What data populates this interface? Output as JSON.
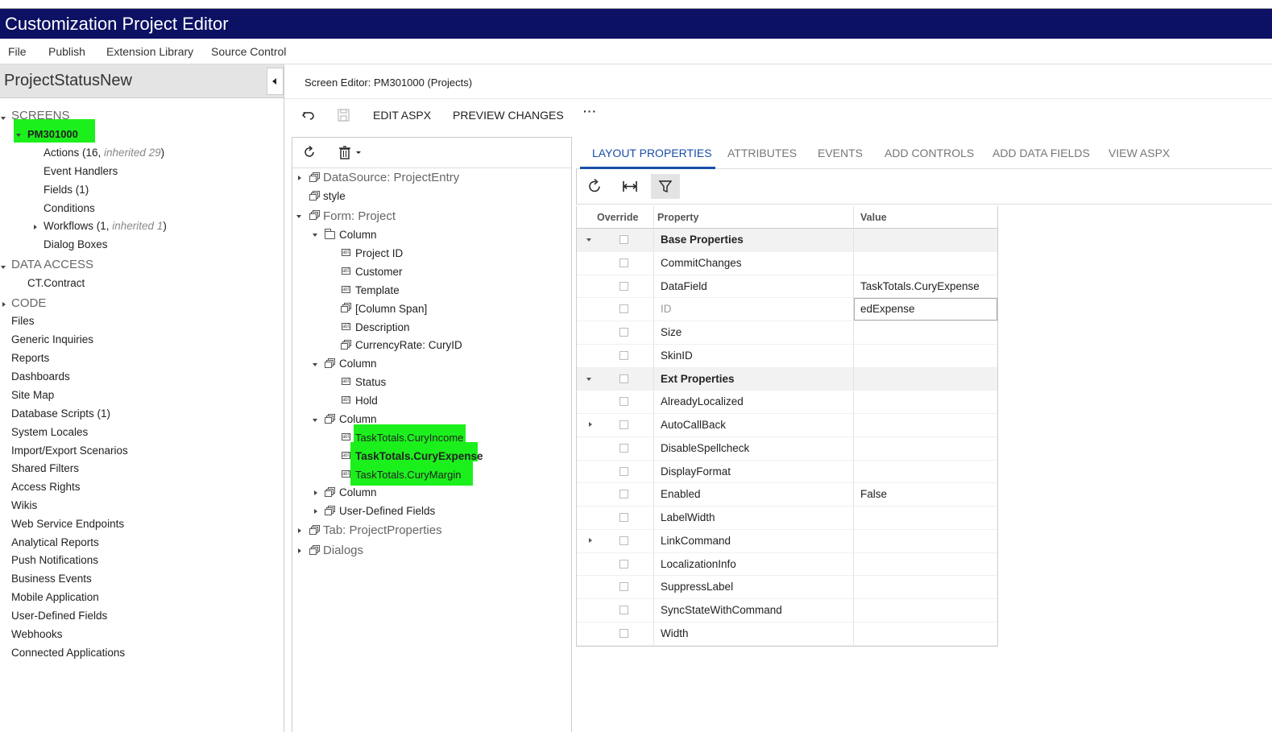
{
  "window": {
    "title": "Customization Project Editor"
  },
  "menu": [
    "File",
    "Publish",
    "Extension Library",
    "Source Control"
  ],
  "project": {
    "name": "ProjectStatusNew"
  },
  "left_tree": {
    "screens": "SCREENS",
    "screen_id": "PM301000",
    "actions_label": "Actions (16, ",
    "actions_inherited": "inherited 29",
    "actions_close": ")",
    "event_handlers": "Event Handlers",
    "fields": "Fields (1)",
    "conditions": "Conditions",
    "workflows_label": "Workflows (1, ",
    "workflows_inherited": "inherited 1",
    "workflows_close": ")",
    "dialog_boxes": "Dialog Boxes",
    "data_access": "DATA ACCESS",
    "contract": "CT.Contract",
    "code": "CODE",
    "items": [
      "Files",
      "Generic Inquiries",
      "Reports",
      "Dashboards",
      "Site Map",
      "Database Scripts (1)",
      "System Locales",
      "Import/Export Scenarios",
      "Shared Filters",
      "Access Rights",
      "Wikis",
      "Web Service Endpoints",
      "Analytical Reports",
      "Push Notifications",
      "Business Events",
      "Mobile Application",
      "User-Defined Fields",
      "Webhooks",
      "Connected Applications"
    ]
  },
  "screen_editor": {
    "title": "Screen Editor: PM301000 (Projects)",
    "edit_aspx": "EDIT ASPX",
    "preview_changes": "PREVIEW CHANGES",
    "more": "···"
  },
  "tree": {
    "datasource": "DataSource: ProjectEntry",
    "style": "style",
    "form": "Form: Project",
    "column": "Column",
    "col1": [
      "Project ID",
      "Customer",
      "Template",
      "[Column Span]",
      "Description",
      "CurrencyRate: CuryID"
    ],
    "col2": [
      "Status",
      "Hold"
    ],
    "col3": [
      "TaskTotals.CuryIncome",
      "TaskTotals.CuryExpense",
      "TaskTotals.CuryMargin"
    ],
    "user_defined": "User-Defined Fields",
    "tab": "Tab: ProjectProperties",
    "dialogs": "Dialogs"
  },
  "tabs": [
    "LAYOUT PROPERTIES",
    "ATTRIBUTES",
    "EVENTS",
    "ADD CONTROLS",
    "ADD DATA FIELDS",
    "VIEW ASPX"
  ],
  "grid": {
    "headers": {
      "override": "Override",
      "property": "Property",
      "value": "Value"
    },
    "rows": [
      {
        "property": "Base Properties",
        "value": ""
      },
      {
        "property": "CommitChanges",
        "value": ""
      },
      {
        "property": "DataField",
        "value": "TaskTotals.CuryExpense"
      },
      {
        "property": "ID",
        "value": "edExpense"
      },
      {
        "property": "Size",
        "value": ""
      },
      {
        "property": "SkinID",
        "value": ""
      },
      {
        "property": "Ext Properties",
        "value": ""
      },
      {
        "property": "AlreadyLocalized",
        "value": ""
      },
      {
        "property": "AutoCallBack",
        "value": ""
      },
      {
        "property": "DisableSpellcheck",
        "value": ""
      },
      {
        "property": "DisplayFormat",
        "value": ""
      },
      {
        "property": "Enabled",
        "value": "False"
      },
      {
        "property": "LabelWidth",
        "value": ""
      },
      {
        "property": "LinkCommand",
        "value": ""
      },
      {
        "property": "LocalizationInfo",
        "value": ""
      },
      {
        "property": "SuppressLabel",
        "value": ""
      },
      {
        "property": "SyncStateWithCommand",
        "value": ""
      },
      {
        "property": "Width",
        "value": ""
      }
    ]
  },
  "colors": {
    "title_bar": "#0c1163",
    "highlight": "#1cf01c",
    "active_tab": "#1a4da8"
  }
}
